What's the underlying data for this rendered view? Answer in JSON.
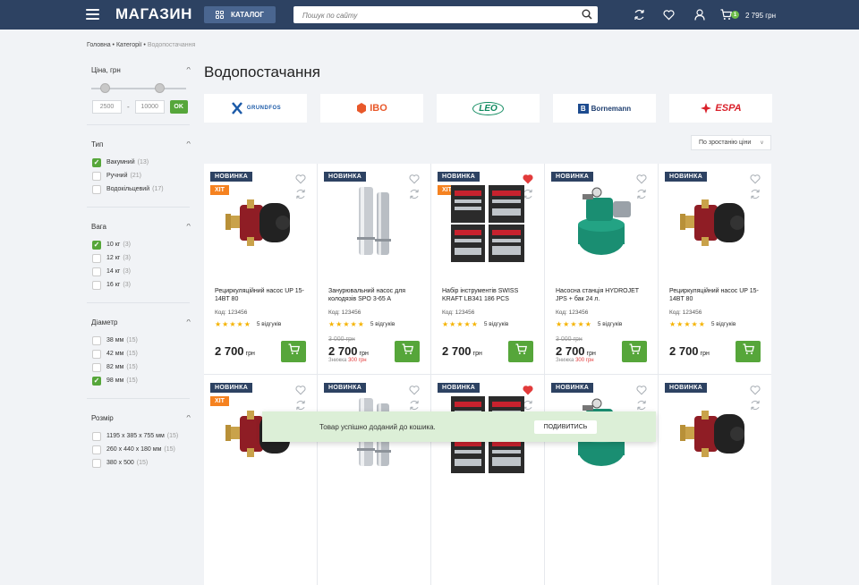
{
  "header": {
    "logo": "МАГАЗИН",
    "catalog_label": "КАТАЛОГ",
    "search_placeholder": "Пошук по сайту",
    "cart_count": "1",
    "cart_total": "2 795 грн"
  },
  "breadcrumbs": {
    "home": "Головна",
    "sep1": " • ",
    "cat": "Категорії",
    "sep2": " • ",
    "current": "Водопостачання"
  },
  "page_title": "Водопостачання",
  "filters": {
    "price": {
      "title": "Ціна, грн",
      "min": "2500",
      "max": "10000",
      "dash": "-",
      "ok": "OK",
      "range_min": 0.1,
      "range_max": 0.75
    },
    "type": {
      "title": "Тип",
      "options": [
        {
          "label": "Вакумний",
          "count": "(13)",
          "checked": true
        },
        {
          "label": "Ручний",
          "count": "(21)",
          "checked": false
        },
        {
          "label": "Водокільцевий",
          "count": "(17)",
          "checked": false
        }
      ]
    },
    "weight": {
      "title": "Вага",
      "options": [
        {
          "label": "10 кг",
          "count": "(3)",
          "checked": true
        },
        {
          "label": "12 кг",
          "count": "(3)",
          "checked": false
        },
        {
          "label": "14 кг",
          "count": "(3)",
          "checked": false
        },
        {
          "label": "16 кг",
          "count": "(3)",
          "checked": false
        }
      ]
    },
    "diameter": {
      "title": "Діаметр",
      "options": [
        {
          "label": "38 мм",
          "count": "(15)",
          "checked": false
        },
        {
          "label": "42 мм",
          "count": "(15)",
          "checked": false
        },
        {
          "label": "82 мм",
          "count": "(15)",
          "checked": false
        },
        {
          "label": "98 мм",
          "count": "(15)",
          "checked": true
        }
      ]
    },
    "size": {
      "title": "Розмір",
      "options": [
        {
          "label": "1195 х 385 х 755 мм",
          "count": "(15)",
          "checked": false
        },
        {
          "label": "260 х 440 х 180 мм",
          "count": "(15)",
          "checked": false
        },
        {
          "label": "380 х 500",
          "count": "(15)",
          "checked": false
        }
      ]
    }
  },
  "brands": [
    "GRUNDFOS",
    "IBO",
    "LEO",
    "Bornemann",
    "ESPA"
  ],
  "sort_label": "По зростанію ціни",
  "products": [
    {
      "new": "НОВИНКА",
      "hit": "ХІТ",
      "liked": false,
      "image": "pump-icon",
      "name": "Рециркуляційний насос UP 15-14BT 80",
      "code": "Код: 123456",
      "reviews": "5 відгуків",
      "old_price": "",
      "price": "2 700",
      "currency": "грн",
      "discount_label": "",
      "discount_value": ""
    },
    {
      "new": "НОВИНКА",
      "hit": "",
      "liked": false,
      "image": "borehole-pump-icon",
      "name": "Занурювальний насос для колодязів SPO 3-65 A",
      "code": "Код: 123456",
      "reviews": "5 відгуків",
      "old_price": "3 000 грн",
      "price": "2 700",
      "currency": "грн",
      "discount_label": "Знижка",
      "discount_value": "300 грн"
    },
    {
      "new": "НОВИНКА",
      "hit": "ХІТ",
      "liked": true,
      "image": "toolset-icon",
      "name": "Набір інструментів SWISS KRAFT LB341 186 PCS",
      "code": "Код: 123456",
      "reviews": "5 відгуків",
      "old_price": "",
      "price": "2 700",
      "currency": "грн",
      "discount_label": "",
      "discount_value": ""
    },
    {
      "new": "НОВИНКА",
      "hit": "",
      "liked": false,
      "image": "pump-station-icon",
      "name": "Насосна станція HYDROJET JPS + бак 24 л.",
      "code": "Код: 123456",
      "reviews": "5 відгуків",
      "old_price": "3 000 грн",
      "price": "2 700",
      "currency": "грн",
      "discount_label": "Знижка",
      "discount_value": "300 грн"
    },
    {
      "new": "НОВИНКА",
      "hit": "",
      "liked": false,
      "image": "pump-icon",
      "name": "Рециркуляційний насос UP 15-14BT 80",
      "code": "Код: 123456",
      "reviews": "5 відгуків",
      "old_price": "",
      "price": "2 700",
      "currency": "грн",
      "discount_label": "",
      "discount_value": ""
    },
    {
      "new": "НОВИНКА",
      "hit": "ХІТ",
      "liked": false,
      "image": "pump-icon",
      "name": "",
      "code": "",
      "reviews": "",
      "old_price": "",
      "price": "",
      "currency": "",
      "discount_label": "",
      "discount_value": ""
    },
    {
      "new": "НОВИНКА",
      "hit": "",
      "liked": false,
      "image": "borehole-pump-icon",
      "name": "",
      "code": "",
      "reviews": "",
      "old_price": "",
      "price": "",
      "currency": "",
      "discount_label": "",
      "discount_value": ""
    },
    {
      "new": "НОВИНКА",
      "hit": "",
      "liked": true,
      "image": "toolset-icon",
      "name": "",
      "code": "",
      "reviews": "",
      "old_price": "",
      "price": "",
      "currency": "",
      "discount_label": "",
      "discount_value": ""
    },
    {
      "new": "НОВИНКА",
      "hit": "",
      "liked": false,
      "image": "pump-station-icon",
      "name": "",
      "code": "",
      "reviews": "",
      "old_price": "",
      "price": "",
      "currency": "",
      "discount_label": "",
      "discount_value": ""
    },
    {
      "new": "НОВИНКА",
      "hit": "",
      "liked": false,
      "image": "pump-icon",
      "name": "",
      "code": "",
      "reviews": "",
      "old_price": "",
      "price": "",
      "currency": "",
      "discount_label": "",
      "discount_value": ""
    }
  ],
  "toast": {
    "message": "Товар успішно доданий до кошика.",
    "button": "ПОДИВИТИСЬ"
  },
  "colors": {
    "header": "#2d4262",
    "accent_green": "#56a63a",
    "hit_orange": "#f58220",
    "star": "#f5b301",
    "like_red": "#e23b3b"
  }
}
